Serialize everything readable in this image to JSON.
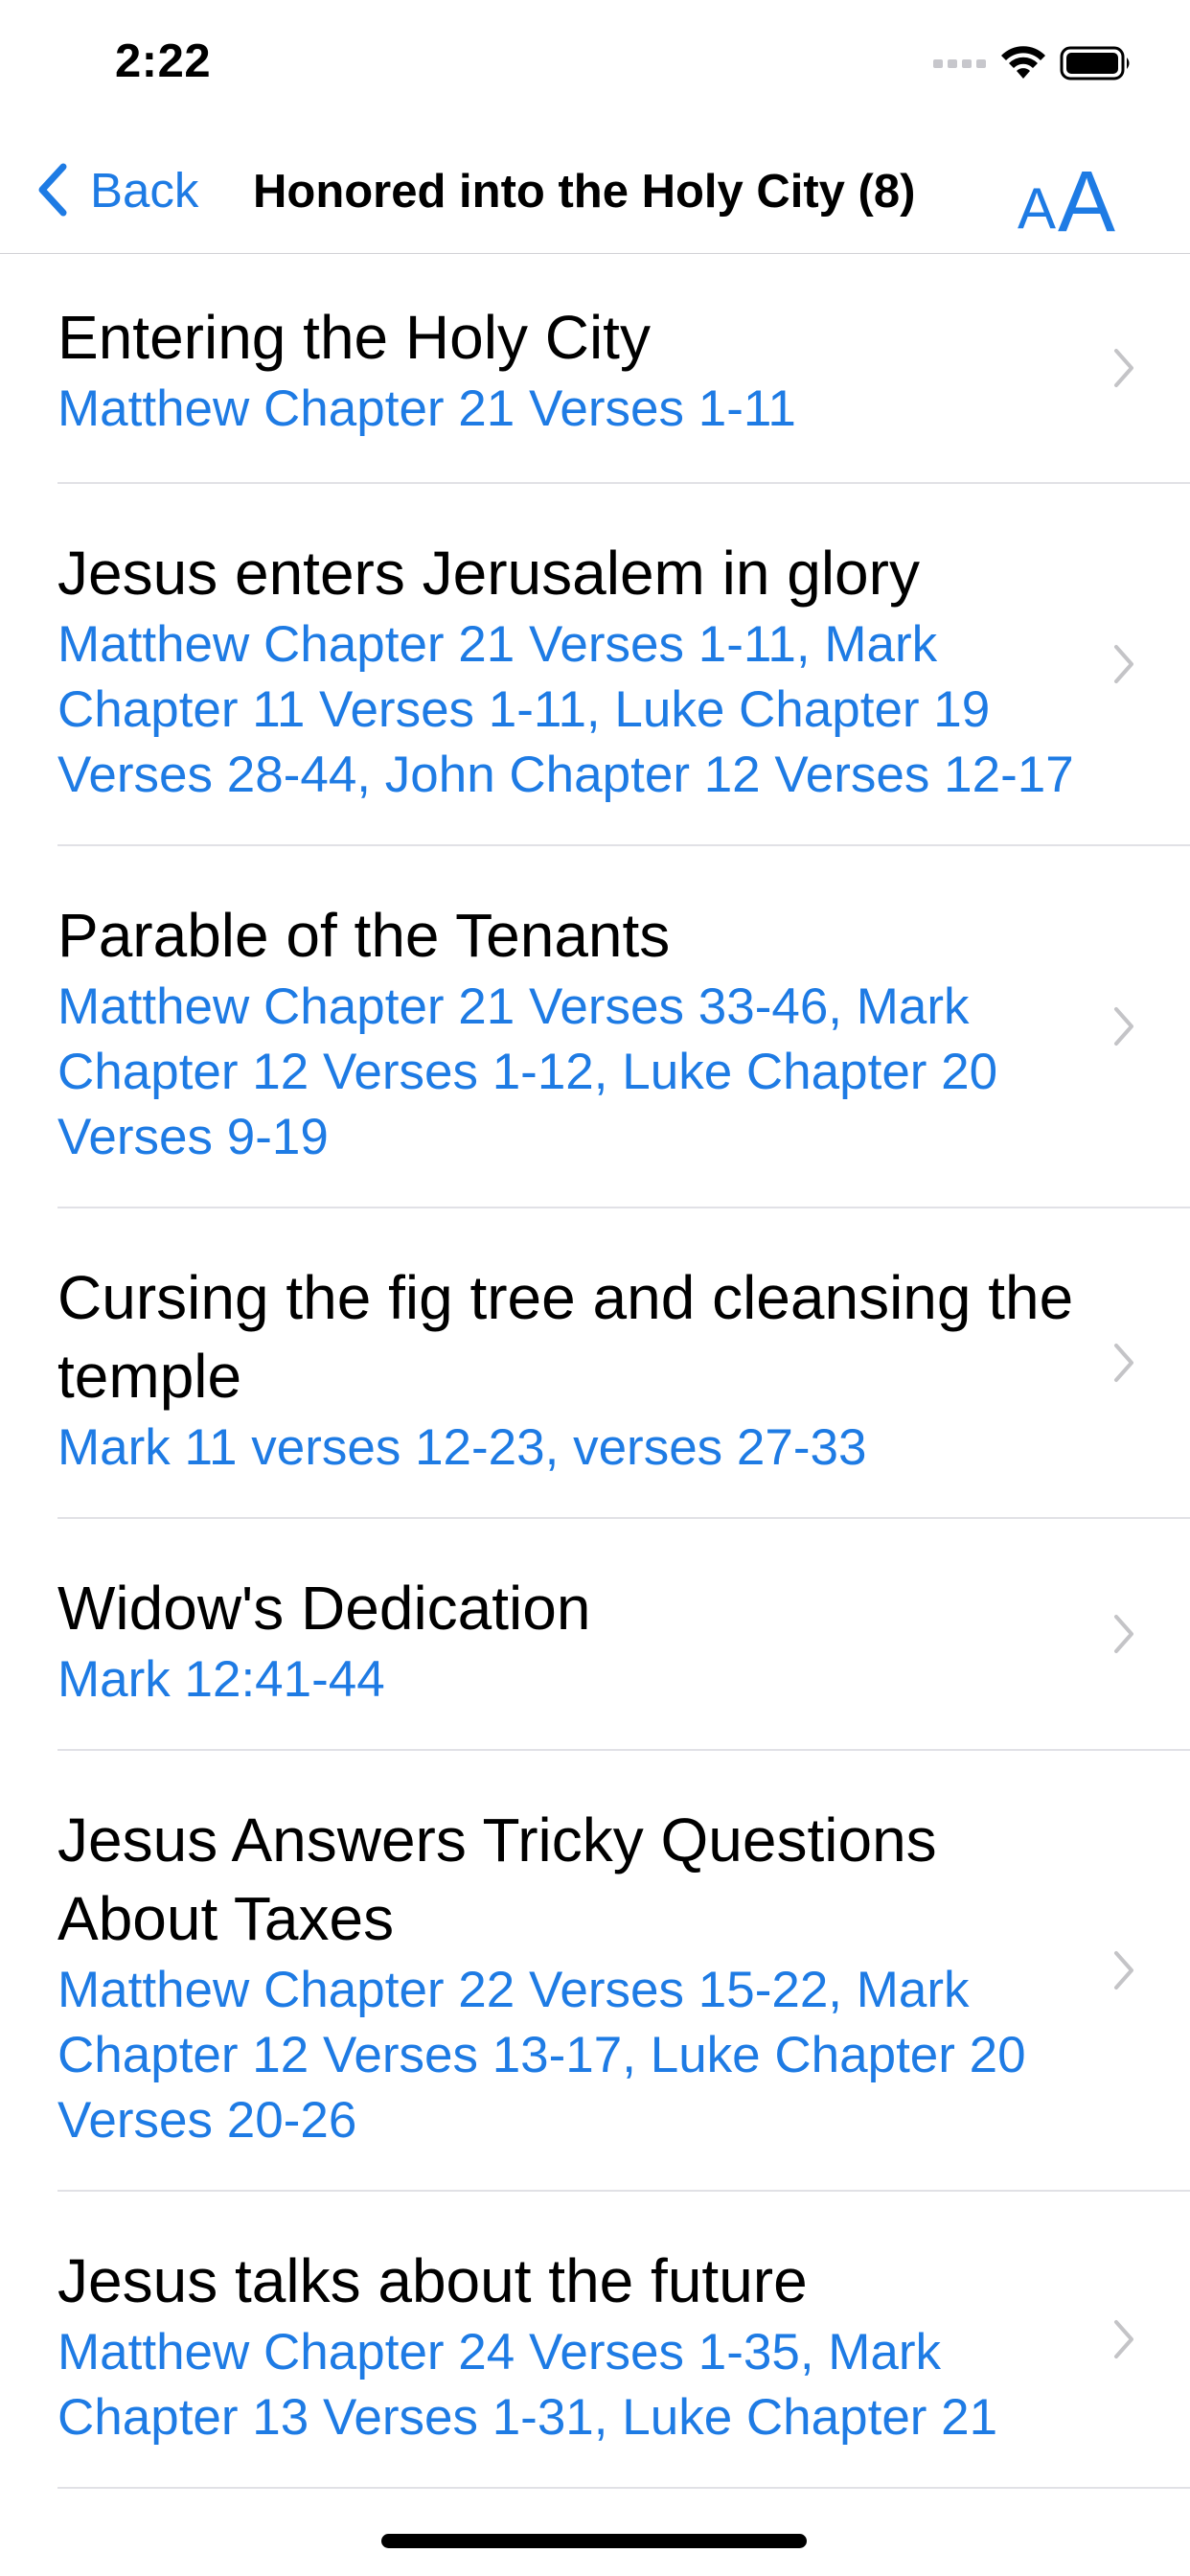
{
  "status_bar": {
    "time": "2:22"
  },
  "nav": {
    "back_label": "Back",
    "title": "Honored into the Holy City (8)",
    "font_button_small": "A",
    "font_button_large": "A"
  },
  "items": [
    {
      "title": "Entering the Holy City",
      "refs": "Matthew Chapter 21 Verses 1-11"
    },
    {
      "title": "Jesus enters Jerusalem in glory",
      "refs": "Matthew Chapter 21 Verses 1-11, Mark Chapter 11 Verses 1-11, Luke Chapter 19 Verses 28-44, John Chapter 12 Verses 12-17"
    },
    {
      "title": "Parable of the Tenants",
      "refs": "Matthew Chapter 21 Verses 33-46, Mark Chapter 12 Verses 1-12, Luke Chapter 20 Verses 9-19"
    },
    {
      "title": "Cursing the fig tree and cleansing the temple",
      "refs": "Mark 11 verses 12-23, verses 27-33"
    },
    {
      "title": "Widow's Dedication",
      "refs": "Mark 12:41-44"
    },
    {
      "title": "Jesus Answers Tricky Questions About Taxes",
      "refs": "Matthew Chapter 22 Verses 15-22, Mark Chapter 12 Verses 13-17, Luke Chapter 20 Verses 20-26"
    },
    {
      "title": "Jesus talks about the future",
      "refs": "Matthew Chapter 24 Verses 1-35, Mark Chapter 13 Verses 1-31, Luke Chapter 21"
    }
  ],
  "colors": {
    "accent": "#1e7be4",
    "separator": "#e1e1e6",
    "chevron": "#c4c4c7"
  },
  "icons": {
    "signal": "signal-icon",
    "wifi": "wifi-icon",
    "battery": "battery-icon",
    "back": "chevron-left-icon",
    "disclosure": "chevron-right-icon"
  }
}
